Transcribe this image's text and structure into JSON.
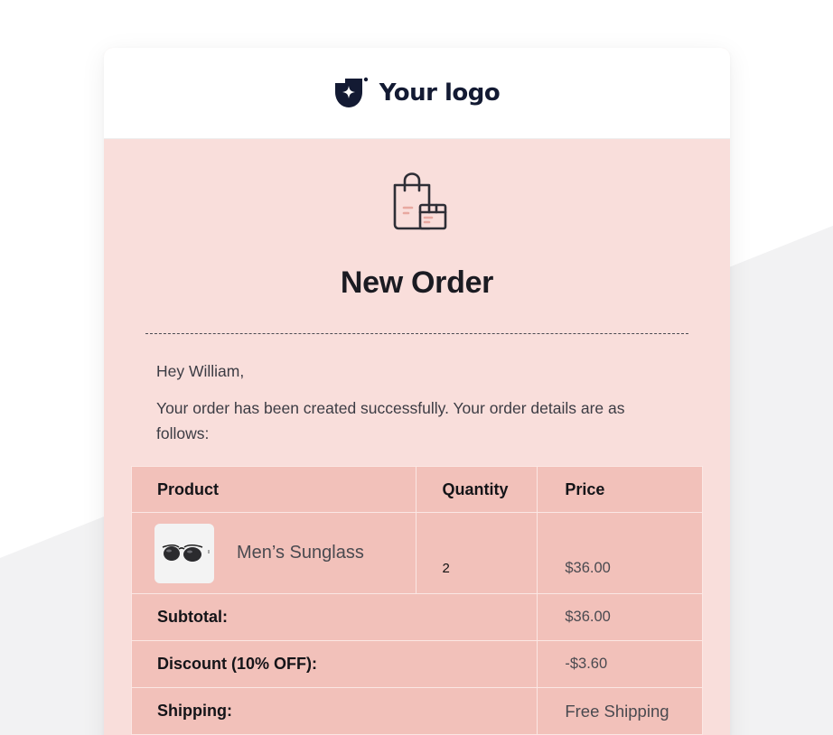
{
  "brand": {
    "logo_text": "Your logo",
    "logo_icon": "shield-star-icon",
    "ink_color": "#131a33"
  },
  "hero": {
    "icon": "shopping-bag-icon",
    "title": "New Order"
  },
  "body": {
    "greeting": "Hey William,",
    "message": "Your order has been created successfully. Your order details are as follows:"
  },
  "table": {
    "headers": {
      "product": "Product",
      "quantity": "Quantity",
      "price": "Price"
    },
    "items": [
      {
        "name": "Men’s Sunglass",
        "image_icon": "sunglasses-icon",
        "quantity": "2",
        "price": "$36.00"
      }
    ],
    "summary": {
      "subtotal_label": "Subtotal:",
      "subtotal_value": "$36.00",
      "discount_label": "Discount (10% OFF):",
      "discount_value": "-$3.60",
      "shipping_label": "Shipping:",
      "shipping_value": "Free Shipping"
    }
  },
  "colors": {
    "card_background": "#f9dedb",
    "table_background": "#f2c1ba",
    "page_background": "#ffffff",
    "backdrop_shape": "#f2f2f3"
  }
}
